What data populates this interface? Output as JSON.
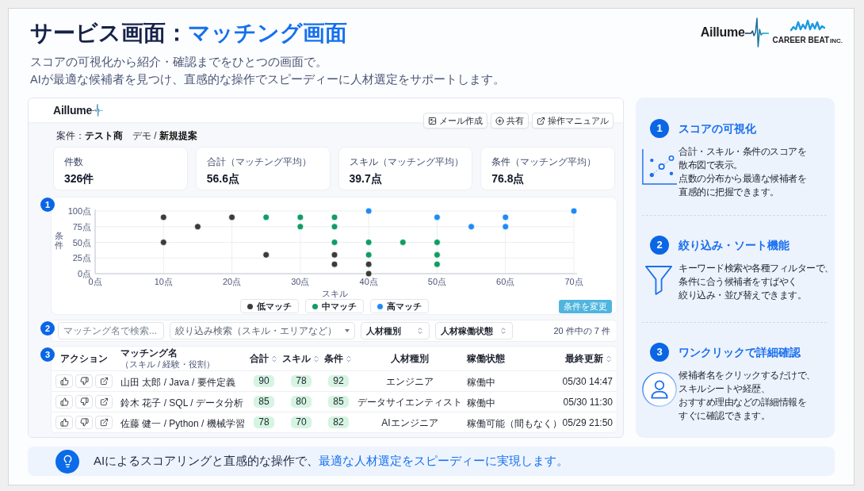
{
  "header": {
    "title": "サービス画面：**マッチング画面**",
    "subtitle": [
      "スコアの可視化から紹介・確認までをひとつの画面で。",
      "AIが最適な候補者を見つけ、直感的な操作でスピーディーに人材選定をサポートします。"
    ]
  },
  "logos": {
    "aillume": "Aillume",
    "career_beat": "CAREER BEAT",
    "career_beat_suffix": "INC."
  },
  "app": {
    "logo": "Aillume",
    "toolbar": [
      "メール作成",
      "共有",
      "操作マニュアル"
    ],
    "project": "案件：**テスト商**　デモ / **新規提案**",
    "stats": [
      {
        "label": "件数",
        "value": "326件"
      },
      {
        "label": "合計",
        "note": "（マッチング平均）",
        "value": "56.6点"
      },
      {
        "label": "スキル",
        "note": "（マッチング平均）",
        "value": "39.7点"
      },
      {
        "label": "条件",
        "note": "（マッチング平均）",
        "value": "76.8点"
      }
    ],
    "scatter": {
      "badge": "1",
      "chart_data": {
        "type": "scatter",
        "xlabel": "スキル",
        "ylabel": "条件",
        "xlim": [
          0,
          70
        ],
        "ylim": [
          0,
          100
        ],
        "xticks": [
          {
            "value": 0,
            "label": "0点"
          },
          {
            "value": 10,
            "label": "10点"
          },
          {
            "value": 20,
            "label": "20点"
          },
          {
            "value": 30,
            "label": "30点"
          },
          {
            "value": 40,
            "label": "40点"
          },
          {
            "value": 50,
            "label": "50点"
          },
          {
            "value": 60,
            "label": "60点"
          },
          {
            "value": 70,
            "label": "70点"
          }
        ],
        "yticks": [
          {
            "value": 0,
            "label": "0点"
          },
          {
            "value": 25,
            "label": "25点"
          },
          {
            "value": 50,
            "label": "50点"
          },
          {
            "value": 75,
            "label": "75点"
          },
          {
            "value": 100,
            "label": "100点"
          }
        ],
        "grid": true,
        "series": [
          {
            "name": "低マッチ",
            "color": "#3d3a3a",
            "x": [
              10,
              20,
              15,
              10,
              25,
              35,
              35,
              40,
              40
            ],
            "values": [
              90,
              90,
              75,
              50,
              30,
              30,
              15,
              15,
              0
            ]
          },
          {
            "name": "中マッチ",
            "color": "#109c64",
            "x": [
              25,
              30,
              35,
              30,
              35,
              35,
              40,
              45,
              50,
              40,
              50,
              50
            ],
            "values": [
              90,
              90,
              90,
              75,
              75,
              50,
              50,
              50,
              50,
              30,
              30,
              15
            ]
          },
          {
            "name": "高マッチ",
            "color": "#1e8cf5",
            "x": [
              40,
              70,
              50,
              60,
              55,
              60
            ],
            "values": [
              100,
              100,
              90,
              90,
              75,
              75
            ]
          }
        ]
      },
      "button": "条件を変更"
    },
    "filters": {
      "badge": "2",
      "search": {
        "placeholder": "マッチング名で検索..."
      },
      "refine": {
        "placeholder": "絞り込み検索（スキル・エリアなど）"
      },
      "selects": [
        "人材種別",
        "人材稼働状態"
      ],
      "count": "20 件中の 7 件"
    },
    "table": {
      "badge": "3",
      "columns": [
        {
          "label": "アクション",
          "sortable": false
        },
        {
          "label": "マッチング名",
          "note": "（スキル / 経験・役割）",
          "sortable": false
        },
        {
          "label": "合計",
          "sortable": true
        },
        {
          "label": "スキル",
          "sortable": true
        },
        {
          "label": "条件",
          "sortable": true
        },
        {
          "label": "人材種別",
          "sortable": false
        },
        {
          "label": "稼働状態",
          "sortable": false
        },
        {
          "label": "最終更新",
          "sortable": true
        }
      ],
      "rows": [
        {
          "name": "山田 太郎 / Java / 要件定義",
          "total": "90",
          "skill": "78",
          "condition": "92",
          "type": "エンジニア",
          "status": "稼働中",
          "updated": "05/30 14:47"
        },
        {
          "name": "鈴木 花子 / SQL / データ分析",
          "total": "85",
          "skill": "80",
          "condition": "85",
          "type": "データサイエンティスト",
          "status": "稼働中",
          "updated": "05/30 11:30"
        },
        {
          "name": "佐藤 健一 / Python / 機械学習",
          "total": "78",
          "skill": "70",
          "condition": "82",
          "type": "AIエンジニア",
          "status": "稼働可能（間もなく）",
          "updated": "05/29 21:50"
        }
      ]
    }
  },
  "features": [
    {
      "number": "1",
      "title": "スコアの可視化",
      "lines": [
        "合計・スキル・条件のスコアを",
        "散布図で表示。",
        "点数の分布から最適な候補者を",
        "直感的に把握できます。"
      ]
    },
    {
      "number": "2",
      "title": "絞り込み・ソート機能",
      "lines": [
        "キーワード検索や各種フィルターで、",
        "条件に合う候補者をすばやく",
        "絞り込み・並び替えできます。"
      ]
    },
    {
      "number": "3",
      "title": "ワンクリックで詳細確認",
      "lines": [
        "候補者名をクリックするだけで、",
        "スキルシートや経歴、",
        "おすすめ理由などの詳細情報を",
        "すぐに確認できます。"
      ]
    }
  ],
  "banner": {
    "text": "AIによるスコアリングと直感的な操作で、**最適な人材選定をスピーディーに実現します。**"
  }
}
